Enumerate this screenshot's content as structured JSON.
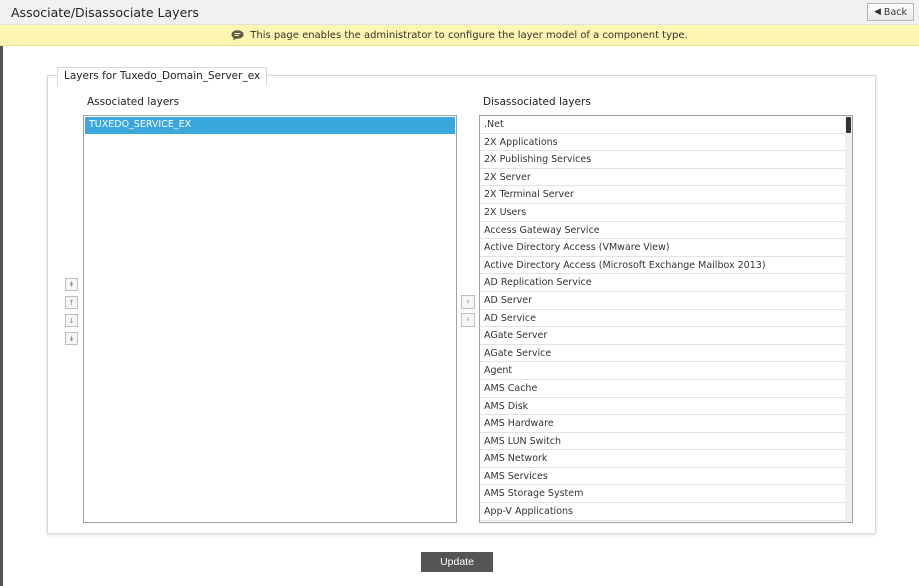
{
  "header": {
    "title": "Associate/Disassociate Layers",
    "back_label": "Back"
  },
  "info": {
    "message": "This page enables the administrator to configure the layer model of a component type."
  },
  "panel": {
    "legend": "Layers for Tuxedo_Domain_Server_ex",
    "associated_label": "Associated layers",
    "disassociated_label": "Disassociated layers",
    "associated_items": [
      "TUXEDO_SERVICE_EX"
    ],
    "disassociated_items": [
      ".Net",
      "2X Applications",
      "2X Publishing Services",
      "2X Server",
      "2X Terminal Server",
      "2X Users",
      "Access Gateway Service",
      "Active Directory Access (VMware View)",
      "Active Directory Access (Microsoft Exchange Mailbox 2013)",
      "AD Replication Service",
      "AD Server",
      "AD Service",
      "AGate Server",
      "AGate Service",
      "Agent",
      "AMS Cache",
      "AMS Disk",
      "AMS Hardware",
      "AMS LUN Switch",
      "AMS Network",
      "AMS Services",
      "AMS Storage System",
      "App-V Applications"
    ]
  },
  "buttons": {
    "update_label": "Update",
    "move_right_icon": "chevron-right-icon",
    "move_left_icon": "chevron-left-icon"
  },
  "colors": {
    "info_bar": "#fdf6b0",
    "selected": "#3aa8dc",
    "update_button": "#555555"
  }
}
